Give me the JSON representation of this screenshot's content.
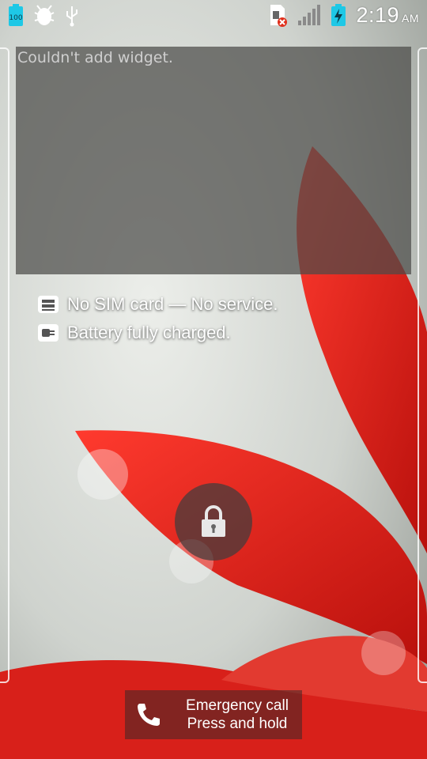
{
  "status_bar": {
    "battery_level": "100",
    "time": "2:19",
    "ampm": "AM",
    "icons": [
      "battery-100-icon",
      "android-debug-icon",
      "usb-icon",
      "no-sim-icon",
      "signal-icon",
      "battery-charging-icon"
    ]
  },
  "widget": {
    "error_text": "Couldn't add widget."
  },
  "lockscreen": {
    "sim_status": "No SIM card — No service.",
    "battery_status": "Battery fully charged."
  },
  "emergency": {
    "line1": "Emergency call",
    "line2": "Press and hold"
  },
  "colors": {
    "accent_cyan": "#1ec8e6",
    "petal_red": "#e0201c"
  }
}
